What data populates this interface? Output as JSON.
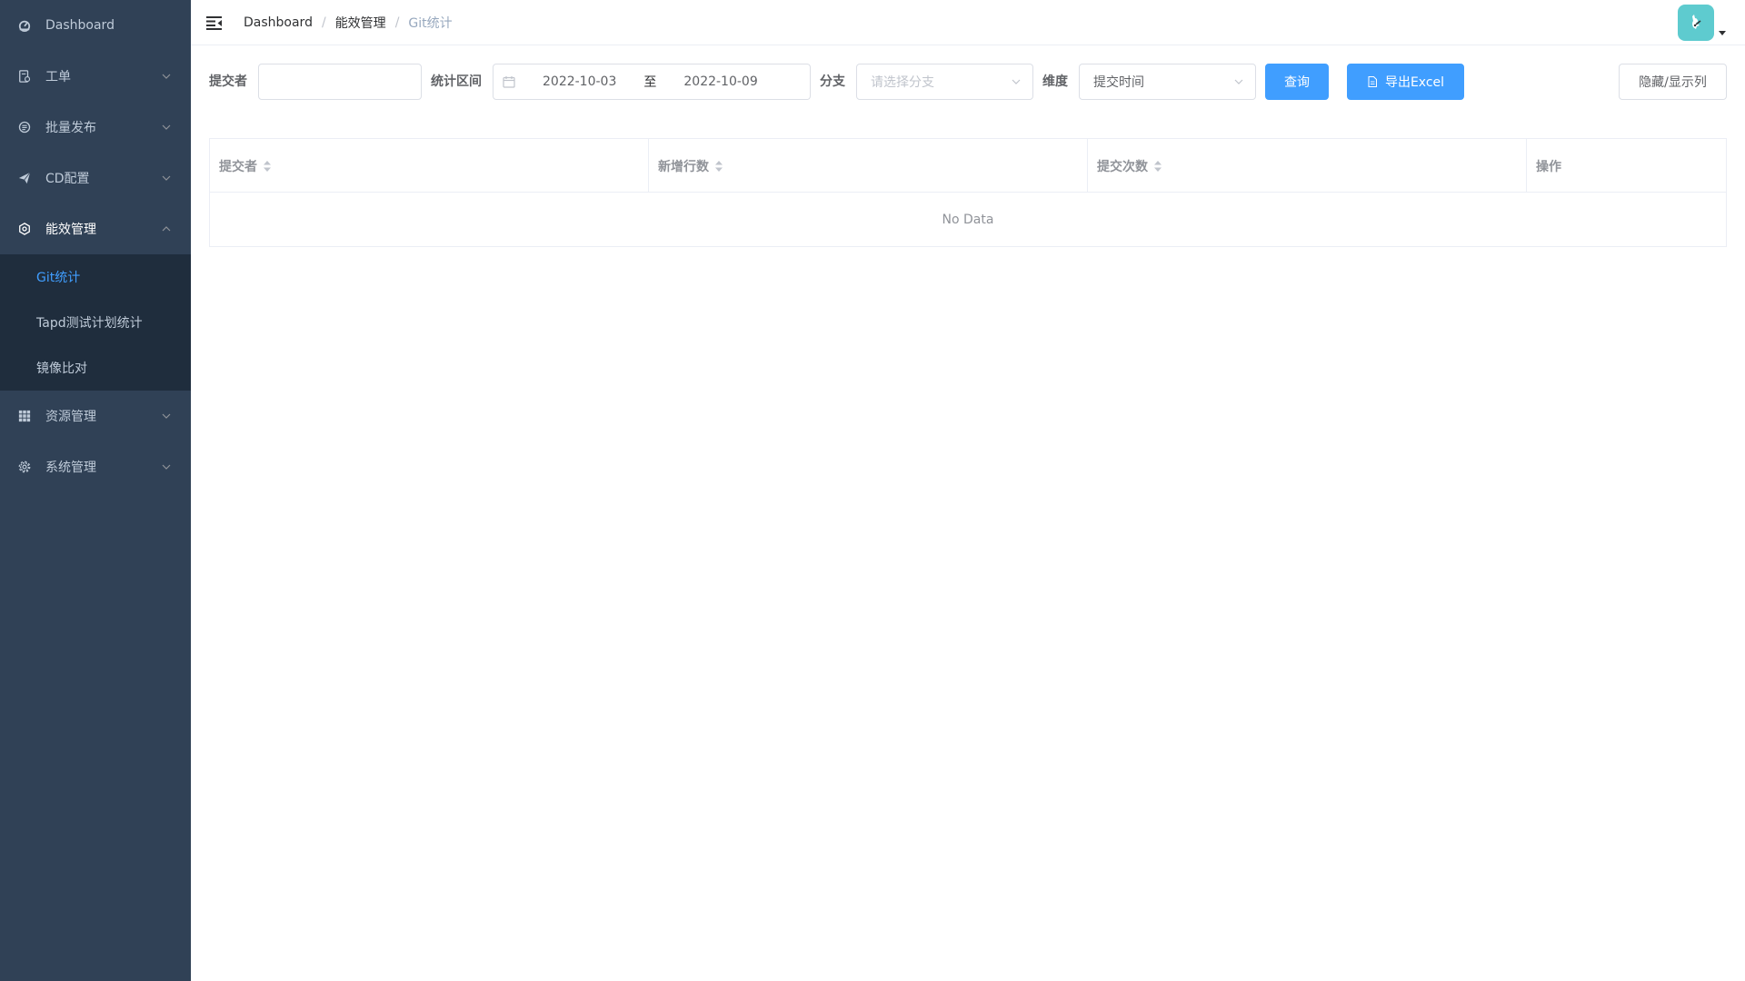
{
  "sidebar": {
    "items": [
      {
        "label": "Dashboard",
        "icon": "dashboard-icon"
      },
      {
        "label": "工单",
        "icon": "ticket-icon"
      },
      {
        "label": "批量发布",
        "icon": "batch-icon"
      },
      {
        "label": "CD配置",
        "icon": "send-icon"
      },
      {
        "label": "能效管理",
        "icon": "efficiency-icon"
      },
      {
        "label": "资源管理",
        "icon": "grid-icon"
      },
      {
        "label": "系统管理",
        "icon": "gear-icon"
      }
    ],
    "submenu": [
      {
        "label": "Git统计",
        "active": true
      },
      {
        "label": "Tapd测试计划统计",
        "active": false
      },
      {
        "label": "镜像比对",
        "active": false
      }
    ]
  },
  "navbar": {
    "breadcrumb": [
      "Dashboard",
      "能效管理",
      "Git统计"
    ]
  },
  "filters": {
    "committer_label": "提交者",
    "committer_value": "",
    "range_label": "统计区间",
    "date_start": "2022-10-03",
    "date_sep": "至",
    "date_end": "2022-10-09",
    "branch_label": "分支",
    "branch_placeholder": "请选择分支",
    "dimension_label": "维度",
    "dimension_value": "提交时间",
    "query_button": "查询",
    "export_button": "导出Excel",
    "toggle_columns_button": "隐藏/显示列"
  },
  "table": {
    "columns": [
      "提交者",
      "新增行数",
      "提交次数",
      "操作"
    ],
    "empty_text": "No Data"
  },
  "colors": {
    "sidebar_bg": "#304156",
    "submenu_bg": "#1f2d3d",
    "accent": "#409eff",
    "avatar_bg": "#5ecbcf"
  }
}
